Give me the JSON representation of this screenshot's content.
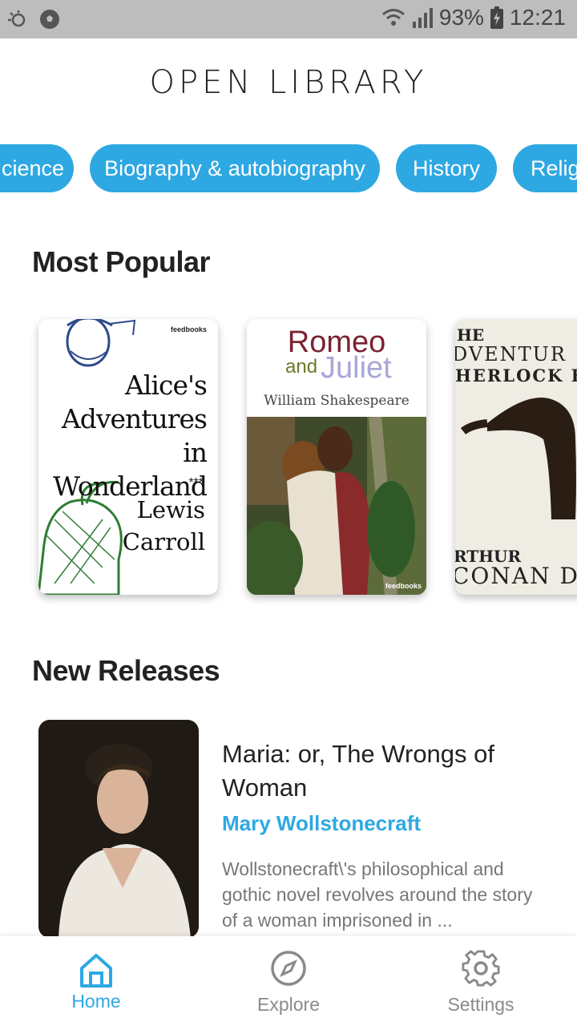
{
  "status_bar": {
    "battery": "93%",
    "time": "12:21"
  },
  "app_title": "OPEN LIBRARY",
  "categories": [
    "cience",
    "Biography & autobiography",
    "History",
    "Relig"
  ],
  "sections": {
    "popular": "Most Popular",
    "releases": "New Releases"
  },
  "popular_books": [
    {
      "title_lines": [
        "Alice's",
        "Adventures in",
        "Wonderland"
      ],
      "stars": "***",
      "author_lines": [
        "Lewis",
        "Carroll"
      ],
      "publisher": "feedbooks"
    },
    {
      "title_top": "Romeo",
      "title_and": "and",
      "title_bottom": "Juliet",
      "author": "William Shakespeare",
      "publisher": "feedbooks"
    },
    {
      "line1": "HE",
      "line2": "DVENTUR",
      "line3": "HERLOCK H",
      "author1": "RTHUR",
      "author2": "CONAN D"
    }
  ],
  "new_release": {
    "title": "Maria: or, The Wrongs of Woman",
    "author": "Mary Wollstonecraft",
    "description": "Wollstonecraft\\'s philosophical and gothic novel revolves around the story of a woman imprisoned in ..."
  },
  "nav": {
    "home": "Home",
    "explore": "Explore",
    "settings": "Settings"
  },
  "colors": {
    "accent": "#2ea8e2",
    "inactive": "#8a8a8a",
    "status_bar": "#bdbdbd"
  }
}
